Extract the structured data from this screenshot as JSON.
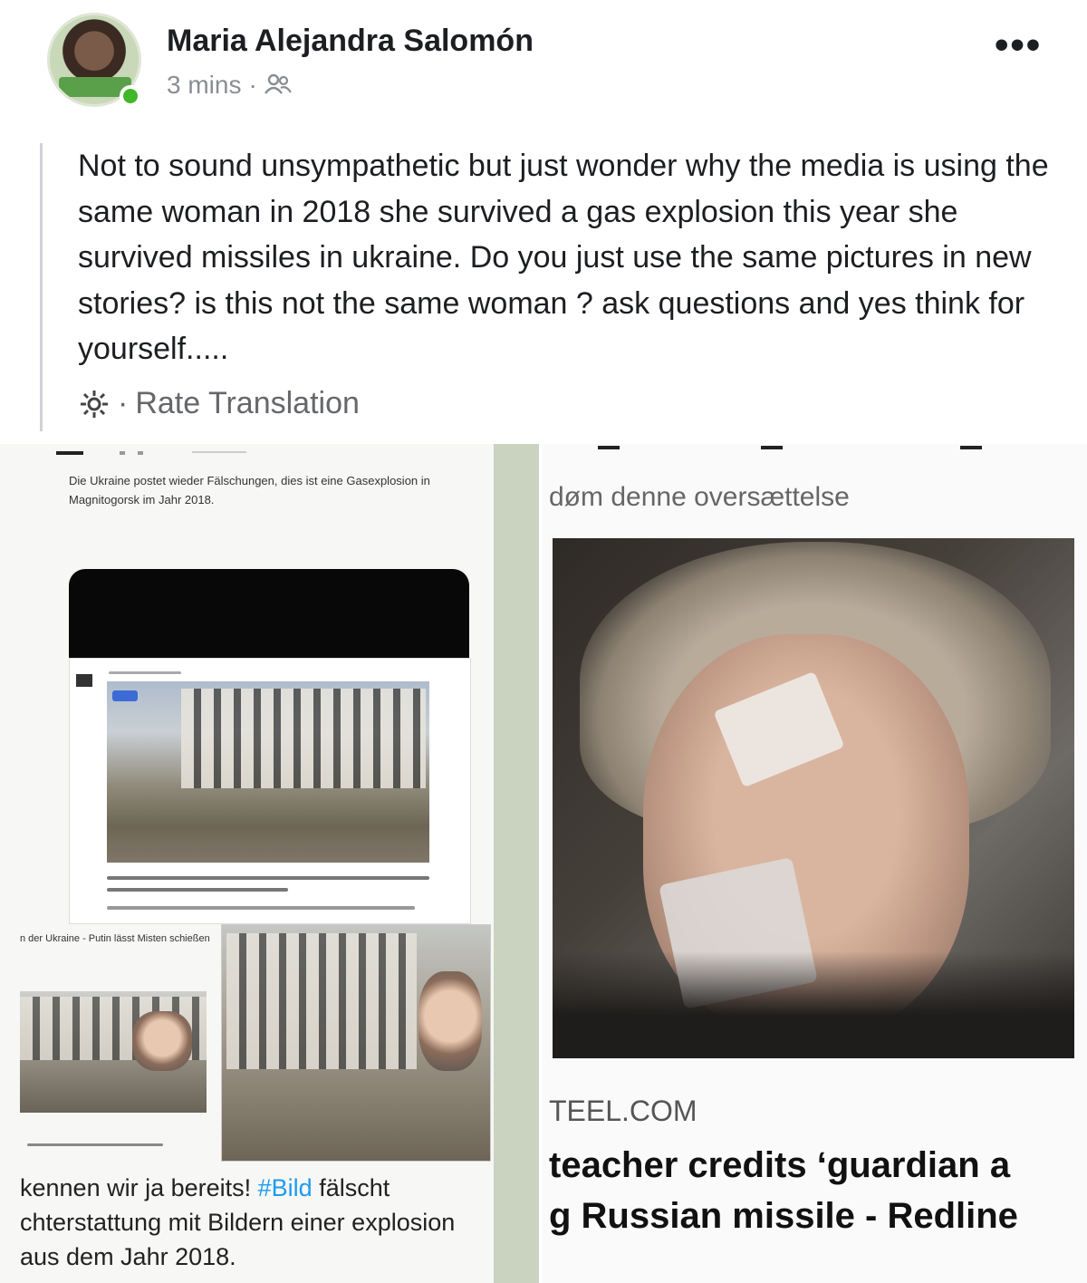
{
  "post": {
    "author": "Maria Alejandra Salomón",
    "time": "3 mins",
    "separator": "·",
    "audience_icon": "friends-icon",
    "more_label": "•••",
    "text": "Not to sound unsympathetic but just wonder why the media is using the same woman in 2018 she survived a gas explosion this year she survived missiles in ukraine. Do you just use the same pictures in new stories? is this not the same woman ? ask questions and yes think for yourself.....",
    "rate_translation": "Rate Translation",
    "rate_icon": "gear-icon"
  },
  "left_screenshot": {
    "caption": "Die Ukraine postet wieder Fälschungen, dies ist eine Gasexplosion in Magnitogorsk im Jahr 2018.",
    "small_label": "n der Ukraine - Putin lässt Misten schießen",
    "bottom_text_prefix": "kennen wir ja bereits! ",
    "hashtag": "#Bild",
    "bottom_text_suffix": " fälscht chterstattung mit Bildern einer explosion aus dem Jahr 2018."
  },
  "right_screenshot": {
    "translation_note": "døm denne oversættelse",
    "site": "TEEL.COM",
    "headline_line1": "teacher credits ‘guardian a",
    "headline_line2": "g Russian missile - Redline"
  },
  "colors": {
    "text": "#1c1e21",
    "meta": "#8a8d91",
    "online": "#42b72a",
    "hashtag": "#1d9bf0"
  }
}
